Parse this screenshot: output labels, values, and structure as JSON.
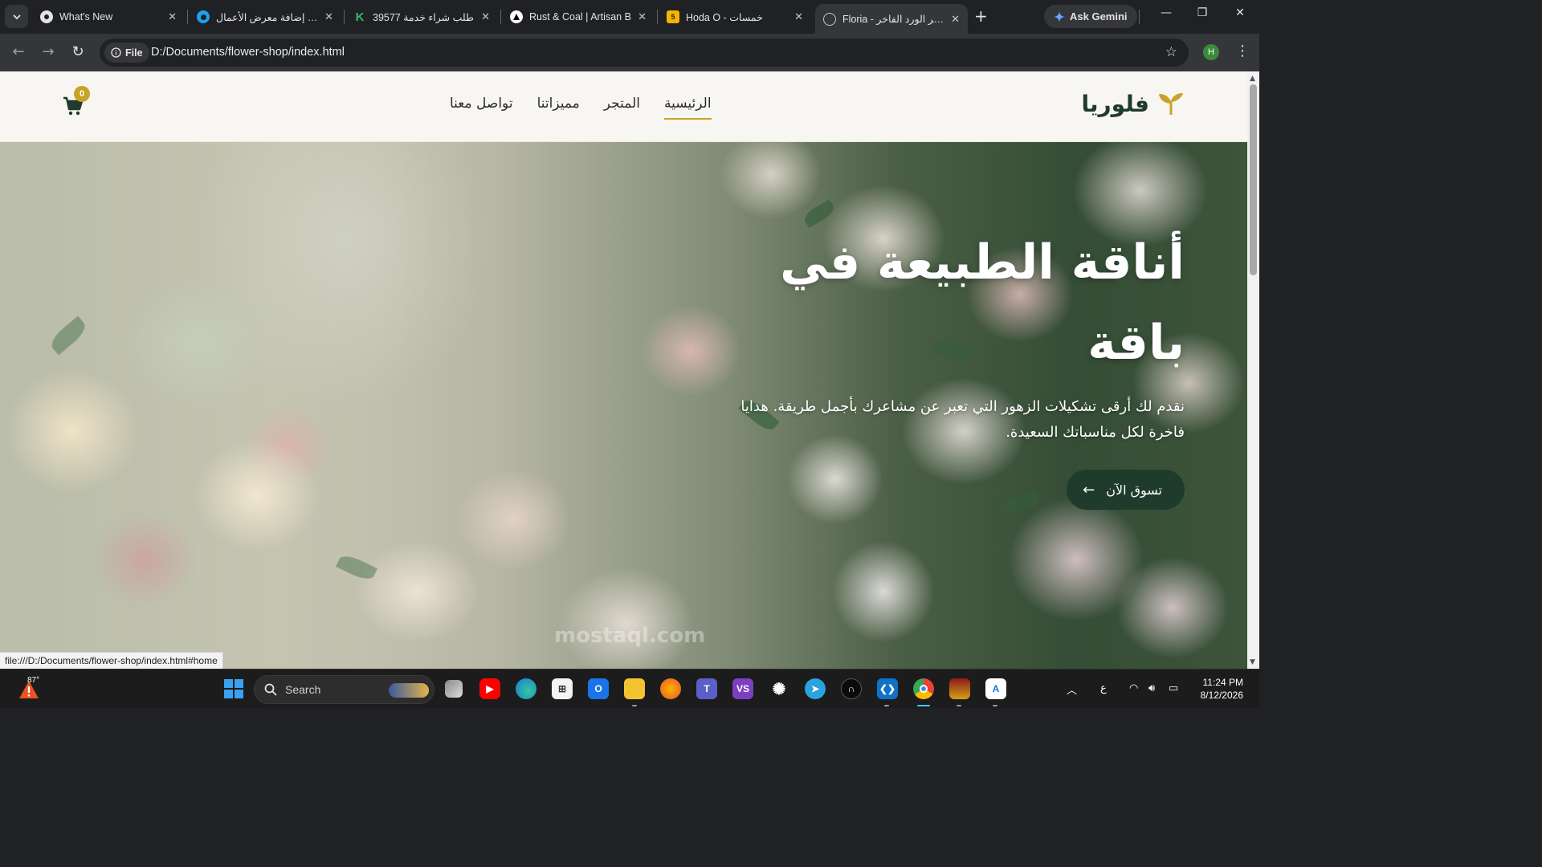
{
  "browser": {
    "tabs": [
      {
        "title": "What's New",
        "favicon": "chrome-icon"
      },
      {
        "title": "إضافة معرض الأعمال | ...",
        "favicon": "circle-blue-icon"
      },
      {
        "title": "طلب شراء خدمة 39577",
        "favicon": "k-green-icon"
      },
      {
        "title": "Rust & Coal | Artisan B",
        "favicon": "triangle-black-icon"
      },
      {
        "title": "Hoda O - خمسات",
        "favicon": "five-badge-icon"
      },
      {
        "title": "Floria - متجر الورد الفاخر",
        "favicon": "globe-icon",
        "active": true
      }
    ],
    "ask_gemini": "Ask Gemini",
    "file_chip": "File",
    "url": "D:/Documents/flower-shop/index.html",
    "profile_initial": "H",
    "status_url": "file:///D:/Documents/flower-shop/index.html#home"
  },
  "site": {
    "logo": "فلوريا",
    "nav": [
      "الرئيسية",
      "المتجر",
      "مميزاتنا",
      "تواصل معنا"
    ],
    "nav_active": "الرئيسية",
    "cart_count": "0",
    "hero": {
      "title": "أناقة الطبيعة في باقة",
      "description": "نقدم لك أرقى تشكيلات الزهور التي تعبر عن مشاعرك بأجمل طريقة. هدايا فاخرة لكل مناسباتك السعيدة.",
      "cta": "تسوق الآن",
      "cta_icon": "arrow-left-icon"
    },
    "watermark": "mostaql.com",
    "colors": {
      "primary": "#1f3b2c",
      "accent": "#c9a227"
    }
  },
  "taskbar": {
    "weather_temp": "87°",
    "search_placeholder": "Search",
    "tray_lang": "ع",
    "time": "11:24 PM",
    "date": "8/12/2026"
  }
}
